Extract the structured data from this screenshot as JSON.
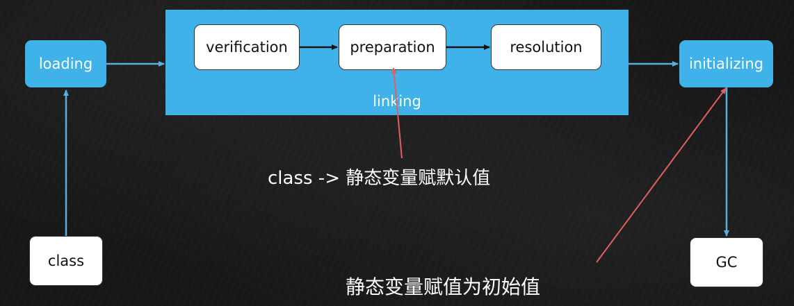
{
  "diagram": {
    "colors": {
      "box_blue": "#3fb2ea",
      "arrow_blue": "#5aaee0",
      "annotation_red": "#e06060",
      "text_white": "#ffffff",
      "text_dark": "#111111"
    },
    "nodes": {
      "loading": "loading",
      "class": "class",
      "initializing": "initializing",
      "gc": "GC",
      "linking": "linking",
      "verification": "verification",
      "preparation": "preparation",
      "resolution": "resolution"
    },
    "annotations": {
      "preparation_note": "class -> 静态变量赋默认值",
      "initializing_note": "静态变量赋值为初始值"
    }
  }
}
